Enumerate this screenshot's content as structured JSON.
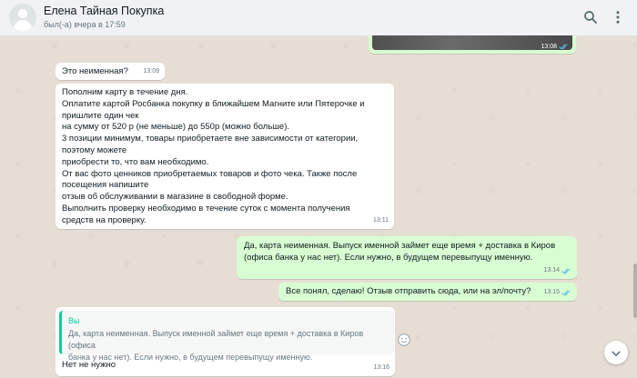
{
  "header": {
    "contact_name": "Елена Тайная Покупка",
    "status": "был(-а) вчера в 17:59"
  },
  "colors": {
    "incoming": "#ffffff",
    "outgoing": "#d9fdd3",
    "read_ticks": "#53bdeb",
    "quote_accent": "#06cf9c"
  },
  "icons": [
    "avatar",
    "search-icon",
    "menu-icon",
    "double-check-icon",
    "emoji-icon",
    "chevron-down-icon"
  ],
  "messages": [
    {
      "kind": "image",
      "direction": "out",
      "time": "13:08",
      "status": "read"
    },
    {
      "direction": "in",
      "text": "Это неименная?",
      "time": "13:09"
    },
    {
      "direction": "in",
      "text": "Пополним карту в течение дня.\nОплатите картой Росбанка покупку в ближайшем Магните или Пятерочке и пришлите один чек\nна сумму от 520 р (не меньше) до 550р (можно больше).\n3 позиции минимум, товары приобретаете вне зависимости от категории, поэтому можете\nприобрести то, что вам необходимо.\nОт вас фото ценников приобретаемых товаров и фото чека. Также после посещения напишите\nотзыв об обслуживании в магазине в свободной форме.\nВыполнить проверку необходимо в течение суток с момента получения средств на проверку.",
      "time": "13:11"
    },
    {
      "direction": "out",
      "text": "Да, карта неименная. Выпуск именной займет еще время + доставка в Киров (офиса банка у нас нет).  Если нужно, в будущем перевыпущу именную.",
      "time": "13:14",
      "status": "read"
    },
    {
      "direction": "out",
      "text": "Все понял, сделаю! Отзыв отправить сюда, или на эл/почту?",
      "time": "13:15",
      "status": "read"
    },
    {
      "direction": "in",
      "quote_author": "Вы",
      "quote_text": "Да, карта неименная. Выпуск именной займет еще время + доставка в Киров (офиса\nбанка у нас нет).  Если нужно, в будущем перевыпущу именную.",
      "text": "Нет не нужно",
      "time": "13:16"
    }
  ]
}
